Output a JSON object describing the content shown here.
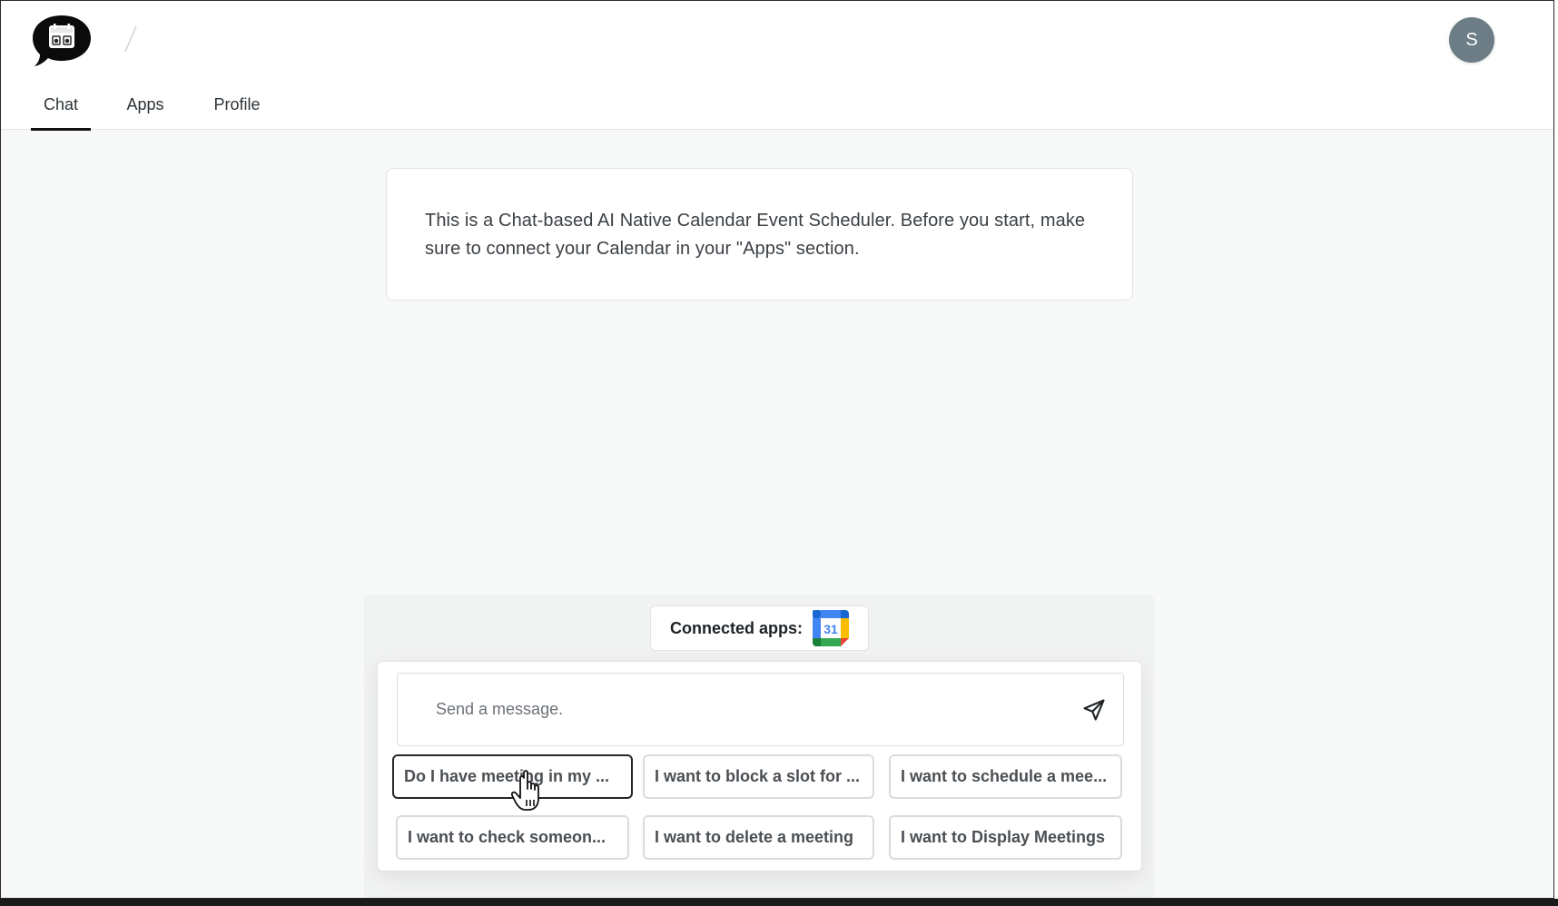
{
  "header": {
    "logo_icon": "calendar-chat-bubble-icon",
    "breadcrumb_separator": "/",
    "avatar_initial": "S",
    "tabs": [
      {
        "label": "Chat",
        "active": true
      },
      {
        "label": "Apps",
        "active": false
      },
      {
        "label": "Profile",
        "active": false
      }
    ]
  },
  "info": {
    "text": "This is a Chat-based AI Native Calendar Event Scheduler. Before you start, make sure to connect your Calendar in your \"Apps\" section."
  },
  "connected_apps": {
    "label": "Connected apps:",
    "apps": [
      {
        "icon": "google-calendar-icon",
        "text": "31"
      }
    ]
  },
  "composer": {
    "placeholder": "Send a message.",
    "send_icon": "send-icon",
    "suggestions": [
      "Do I have meeting in my ...",
      "I want to block a slot for ...",
      "I want to schedule a mee...",
      "I want to check someon...",
      "I want to delete a meeting",
      "I want to Display Meetings"
    ]
  },
  "colors": {
    "background": "#f7f8f8",
    "avatar": "#6d7d86",
    "gcal_blue": "#4285F4",
    "gcal_green": "#34A853",
    "gcal_yellow": "#FBBC04",
    "gcal_red": "#EA4335"
  }
}
